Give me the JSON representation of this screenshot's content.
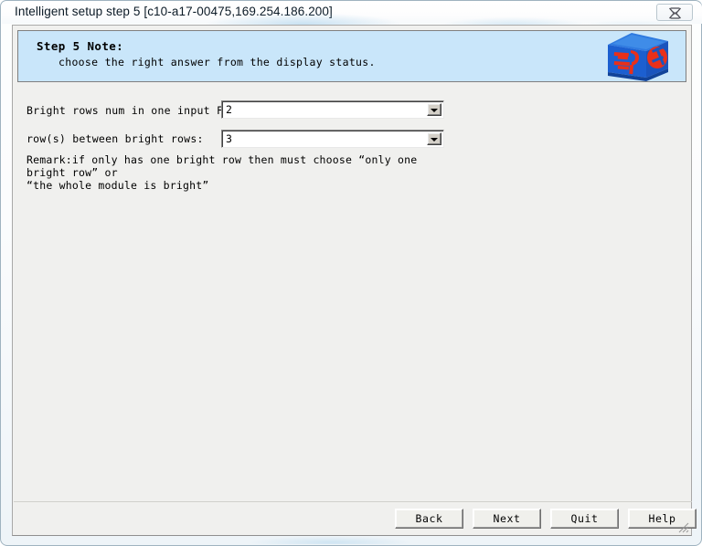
{
  "window": {
    "title": "Intelligent setup step 5 [c10-a17-00475,169.254.186.200]",
    "close_label": "close-icon"
  },
  "header": {
    "step_title": "Step 5 Note:",
    "step_subtitle": "choose the right answer from the display status.",
    "logo_name": "company-cube-logo"
  },
  "form": {
    "rows": [
      {
        "label": "Bright rows num in one input F/C :",
        "value": "2"
      },
      {
        "label": "row(s) between bright rows:",
        "value": "3"
      }
    ],
    "remark": "Remark:if only has one bright row then must choose “only one bright row” or\n“the whole module is bright”"
  },
  "footer": {
    "buttons": [
      {
        "label": "Back"
      },
      {
        "label": "Next"
      },
      {
        "label": "Quit"
      },
      {
        "label": "Help"
      }
    ]
  },
  "colors": {
    "banner_bg": "#c9e6fa",
    "client_bg": "#f0f0ee",
    "button_face": "#f0f0ec",
    "logo_blue": "#1c5fd0",
    "logo_red": "#e8301a"
  }
}
